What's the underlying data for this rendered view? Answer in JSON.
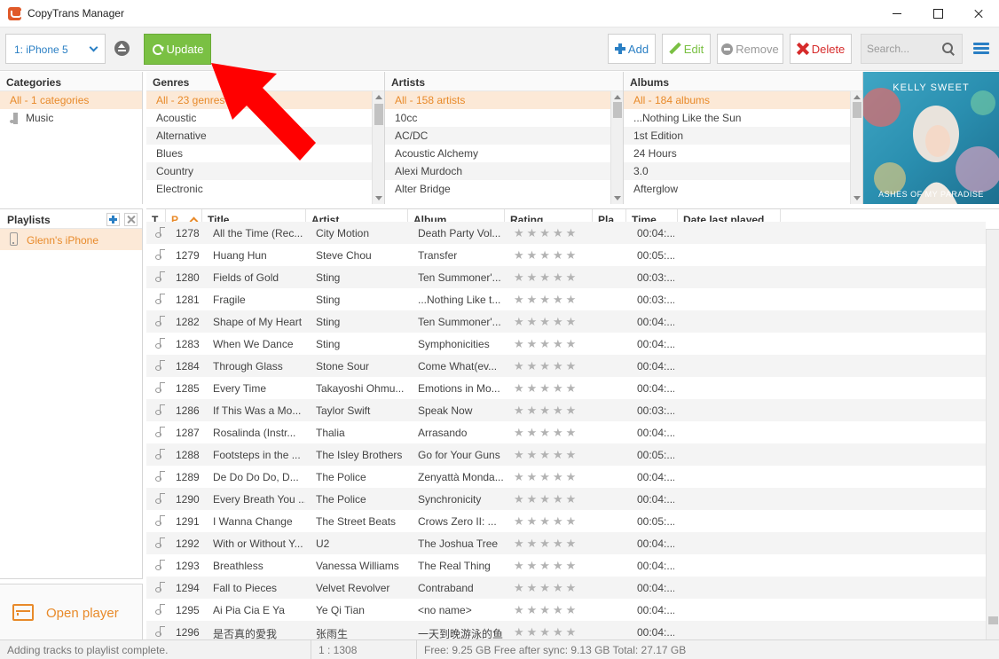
{
  "window": {
    "title": "CopyTrans Manager"
  },
  "toolbar": {
    "device": "1: iPhone 5",
    "update_label": "Update",
    "add_label": "Add",
    "edit_label": "Edit",
    "remove_label": "Remove",
    "delete_label": "Delete",
    "search_placeholder": "Search..."
  },
  "browser": {
    "categories": {
      "header": "Categories",
      "items": [
        "All - 1 categories",
        "Music"
      ]
    },
    "genres": {
      "header": "Genres",
      "items": [
        "All - 23 genres",
        "Acoustic",
        "Alternative",
        "Blues",
        "Country",
        "Electronic"
      ]
    },
    "artists": {
      "header": "Artists",
      "items": [
        "All - 158 artists",
        "10cc",
        "AC/DC",
        "Acoustic Alchemy",
        "Alexi Murdoch",
        "Alter Bridge"
      ]
    },
    "albums": {
      "header": "Albums",
      "items": [
        "All - 184 albums",
        "...Nothing Like the Sun",
        "1st Edition",
        "24 Hours",
        "3.0",
        "Afterglow"
      ]
    },
    "album_art": {
      "title": "KELLY SWEET",
      "subtitle": "ASHES OF MY PARADISE"
    }
  },
  "playlists": {
    "header": "Playlists",
    "items": [
      "Glenn's iPhone"
    ]
  },
  "player": {
    "label": "Open player"
  },
  "tracks": {
    "columns": [
      "T...",
      "P...",
      "Title",
      "Artist",
      "Album",
      "Rating",
      "Pla...",
      "Time",
      "Date last played"
    ],
    "rows": [
      {
        "pos": "1278",
        "title": "All the Time (Rec...",
        "artist": "City Motion",
        "album": "Death Party Vol...",
        "time": "00:04:..."
      },
      {
        "pos": "1279",
        "title": "Huang Hun",
        "artist": "Steve Chou",
        "album": "Transfer",
        "time": "00:05:..."
      },
      {
        "pos": "1280",
        "title": "Fields of Gold",
        "artist": "Sting",
        "album": "Ten Summoner'...",
        "time": "00:03:..."
      },
      {
        "pos": "1281",
        "title": "Fragile",
        "artist": "Sting",
        "album": "...Nothing Like t...",
        "time": "00:03:..."
      },
      {
        "pos": "1282",
        "title": "Shape of My Heart",
        "artist": "Sting",
        "album": "Ten Summoner'...",
        "time": "00:04:..."
      },
      {
        "pos": "1283",
        "title": "When We Dance",
        "artist": "Sting",
        "album": "Symphonicities",
        "time": "00:04:..."
      },
      {
        "pos": "1284",
        "title": "Through Glass",
        "artist": "Stone Sour",
        "album": "Come What(ev...",
        "time": "00:04:..."
      },
      {
        "pos": "1285",
        "title": "Every Time",
        "artist": "Takayoshi Ohmu...",
        "album": "Emotions in Mo...",
        "time": "00:04:..."
      },
      {
        "pos": "1286",
        "title": "If This Was a Mo...",
        "artist": "Taylor Swift",
        "album": "Speak Now",
        "time": "00:03:..."
      },
      {
        "pos": "1287",
        "title": "Rosalinda (Instr...",
        "artist": "Thalia",
        "album": "Arrasando",
        "time": "00:04:..."
      },
      {
        "pos": "1288",
        "title": "Footsteps in the ...",
        "artist": "The Isley Brothers",
        "album": "Go for Your Guns",
        "time": "00:05:..."
      },
      {
        "pos": "1289",
        "title": "De Do Do Do, D...",
        "artist": "The Police",
        "album": "Zenyattà Monda...",
        "time": "00:04:..."
      },
      {
        "pos": "1290",
        "title": "Every Breath You ...",
        "artist": "The Police",
        "album": "Synchronicity",
        "time": "00:04:..."
      },
      {
        "pos": "1291",
        "title": "I Wanna Change",
        "artist": "The Street Beats",
        "album": "Crows Zero II: ...",
        "time": "00:05:..."
      },
      {
        "pos": "1292",
        "title": "With or Without Y...",
        "artist": "U2",
        "album": "The Joshua Tree",
        "time": "00:04:..."
      },
      {
        "pos": "1293",
        "title": "Breathless",
        "artist": "Vanessa Williams",
        "album": "The Real Thing",
        "time": "00:04:..."
      },
      {
        "pos": "1294",
        "title": "Fall to Pieces",
        "artist": "Velvet Revolver",
        "album": "Contraband",
        "time": "00:04:..."
      },
      {
        "pos": "1295",
        "title": "Ai Pia Cia E Ya",
        "artist": "Ye Qi Tian",
        "album": "<no name>",
        "time": "00:04:..."
      },
      {
        "pos": "1296",
        "title": "是否真的愛我",
        "artist": "张雨生",
        "album": "一天到晚游泳的鱼",
        "time": "00:04:..."
      }
    ],
    "rating_stars": "★★★★★"
  },
  "status": {
    "message": "Adding tracks to playlist complete.",
    "count": "1 : 1308",
    "space": "Free: 9.25 GB Free after sync: 9.13 GB Total: 27.17 GB"
  },
  "colors": {
    "accent": "#e88a2a",
    "blue": "#2a7fc4",
    "green": "#7ac043",
    "red": "#d62b2b",
    "arrow": "#ff0000"
  }
}
